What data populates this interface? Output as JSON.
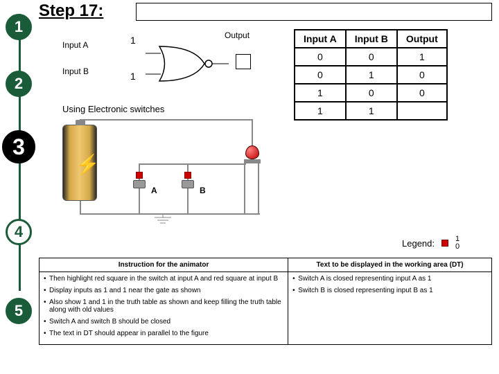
{
  "title": "Step 17:",
  "sidebar": {
    "steps": [
      "1",
      "2",
      "3",
      "4",
      "5"
    ]
  },
  "gate": {
    "inputA_label": "Input A",
    "inputB_label": "Input B",
    "output_label": "Output",
    "valA": "1",
    "valB": "1"
  },
  "truth": {
    "headers": [
      "Input A",
      "Input B",
      "Output"
    ],
    "rows": [
      [
        "0",
        "0",
        "1"
      ],
      [
        "0",
        "1",
        "0"
      ],
      [
        "1",
        "0",
        "0"
      ],
      [
        "1",
        "1",
        ""
      ]
    ]
  },
  "subtitle": "Using Electronic switches",
  "circuit": {
    "switchA": "A",
    "switchB": "B"
  },
  "legend": {
    "label": "Legend:",
    "one": "1",
    "zero": "0"
  },
  "instr": {
    "left_header": "Instruction for the animator",
    "right_header": "Text to be displayed in the working area (DT)",
    "left": [
      "Then highlight red square in the switch at input A and red square at input B",
      "Display inputs as 1 and 1 near the gate as shown",
      "Also show 1 and 1 in the truth table as shown and keep filling the truth table along with old values",
      "Switch A and switch B should be closed",
      "The text in DT should appear in parallel to the figure"
    ],
    "right": [
      "Switch A is closed representing input A as 1",
      "Switch B is closed representing input B as 1"
    ]
  },
  "chart_data": {
    "type": "table",
    "title": "NOR gate truth table (partial, step 17)",
    "columns": [
      "Input A",
      "Input B",
      "Output"
    ],
    "rows": [
      {
        "Input A": 0,
        "Input B": 0,
        "Output": 1
      },
      {
        "Input A": 0,
        "Input B": 1,
        "Output": 0
      },
      {
        "Input A": 1,
        "Input B": 0,
        "Output": 0
      },
      {
        "Input A": 1,
        "Input B": 1,
        "Output": null
      }
    ]
  }
}
